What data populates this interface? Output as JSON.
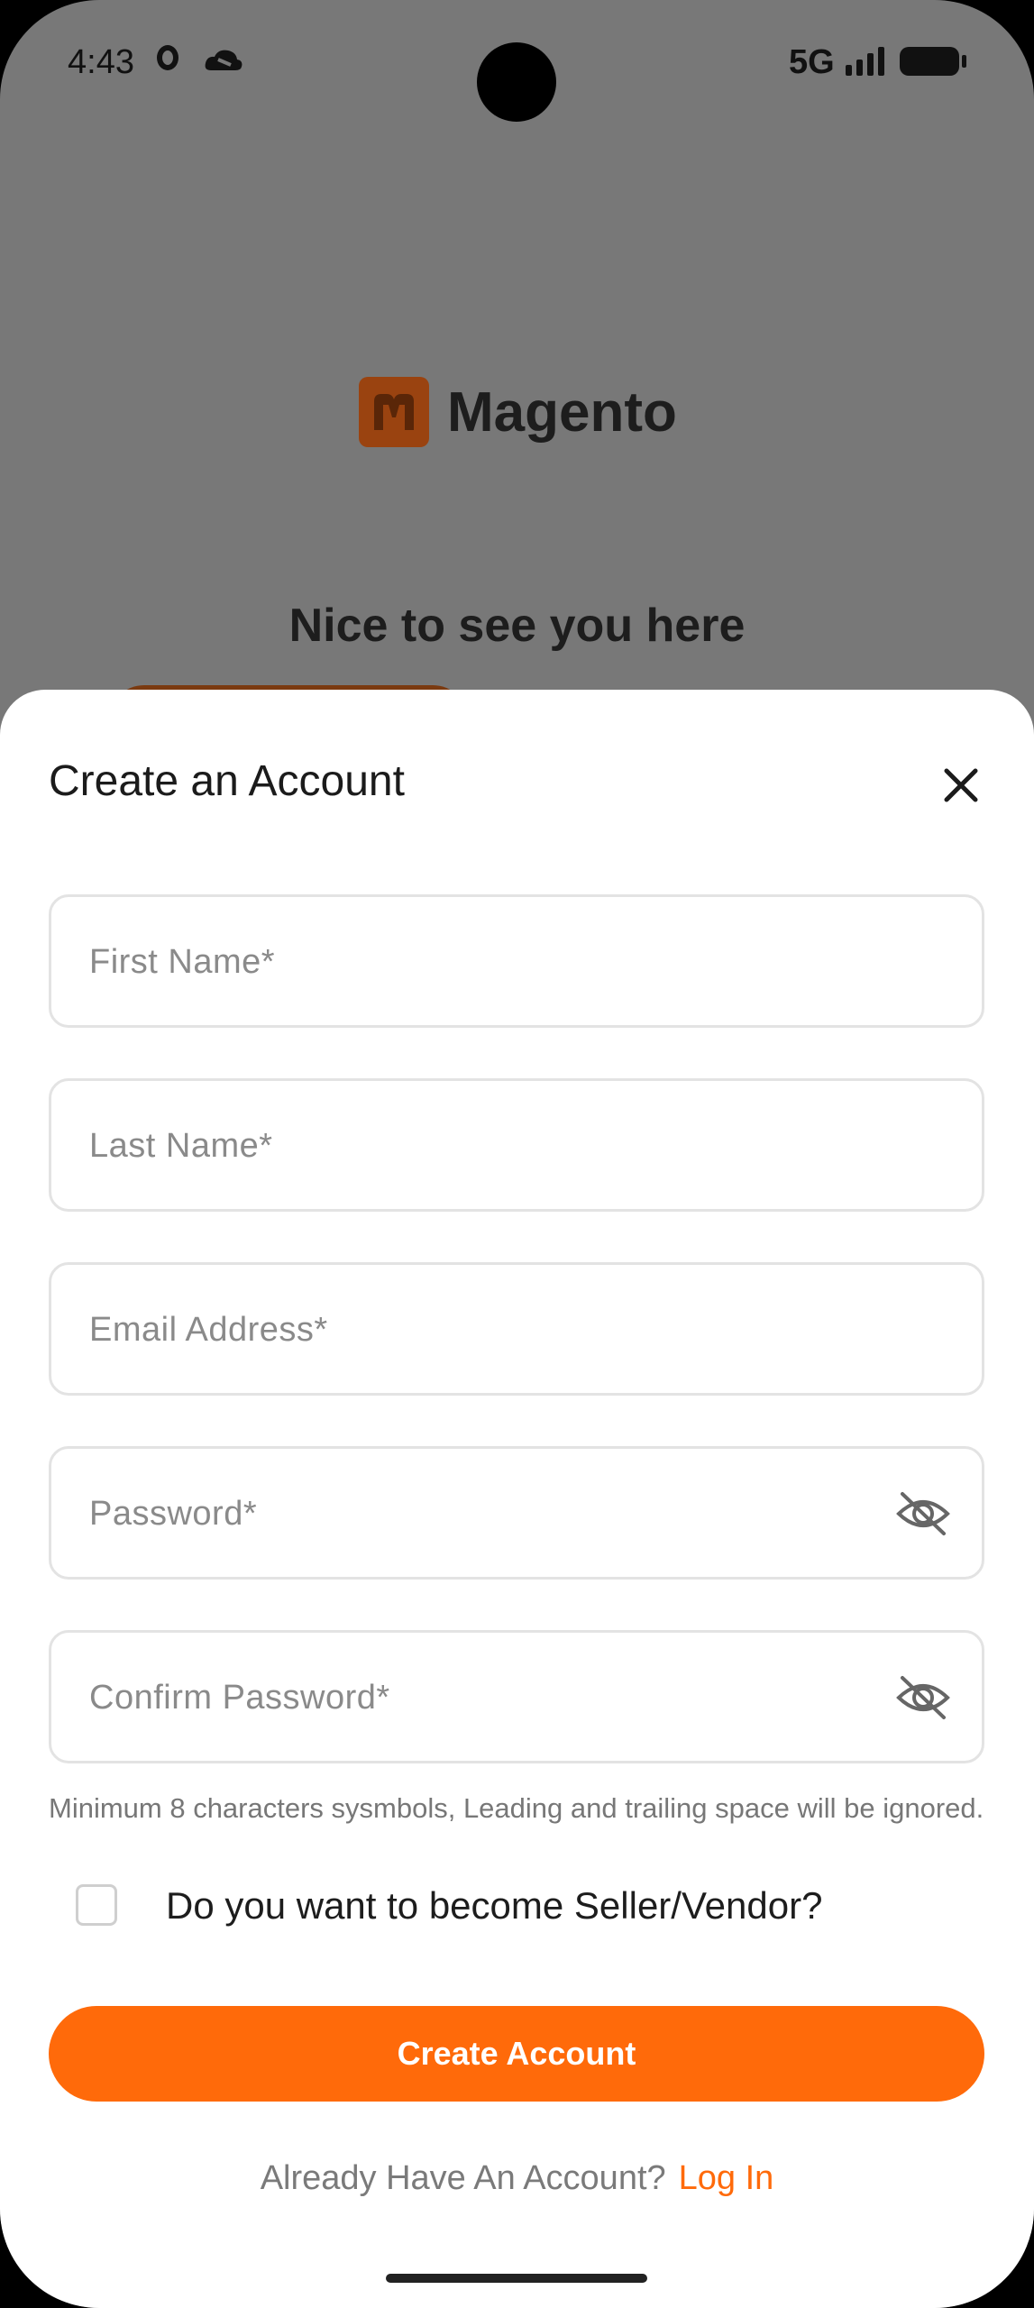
{
  "status_bar": {
    "time": "4:43",
    "network": "5G"
  },
  "background": {
    "brand": "Magento",
    "greeting": "Nice to see you here",
    "accent": "#9a4310"
  },
  "sheet": {
    "title": "Create an Account",
    "fields": {
      "first_name": {
        "placeholder": "First Name*",
        "value": ""
      },
      "last_name": {
        "placeholder": "Last Name*",
        "value": ""
      },
      "email": {
        "placeholder": "Email Address*",
        "value": ""
      },
      "password": {
        "placeholder": "Password*",
        "value": ""
      },
      "confirm_password": {
        "placeholder": "Confirm Password*",
        "value": ""
      }
    },
    "password_hint": "Minimum 8 characters sysmbols, Leading and trailing space will be ignored.",
    "seller_checkbox_label": "Do you want to become Seller/Vendor?",
    "seller_checked": false,
    "create_button": "Create Account",
    "login_prompt": "Already Have An Account?",
    "login_link": "Log In",
    "accent_color": "#ff6a0a"
  },
  "icons": [
    "close-icon",
    "eye-off-icon",
    "checkbox-icon",
    "magento-logo-icon",
    "signal-icon",
    "battery-icon"
  ]
}
